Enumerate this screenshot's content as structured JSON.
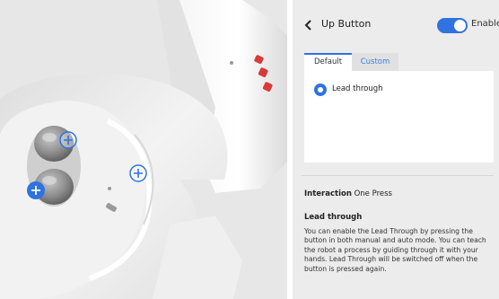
{
  "panel": {
    "title": "Up Button",
    "toggle_label": "Enabled",
    "toggle_on": true,
    "tabs": [
      {
        "label": "Default",
        "active": true
      },
      {
        "label": "Custom",
        "active": false
      }
    ],
    "radio_option": "Lead through",
    "interaction_label": "Interaction",
    "interaction_value": "One Press",
    "section_title": "Lead through",
    "description": "You can enable the Lead Through by pressing the button in both manual and auto mode. You can teach the robot a process by guiding through it with your hands. Lead Through will be switched off when the button is pressed again."
  },
  "colors": {
    "accent": "#2f73e0",
    "viewport_bg": "#e7e7e7",
    "panel_bg": "#ececec",
    "robot_logo": "#d93a3a"
  },
  "icons": {
    "back": "chevron-left-icon",
    "hotspot": "plus-circle-icon"
  }
}
